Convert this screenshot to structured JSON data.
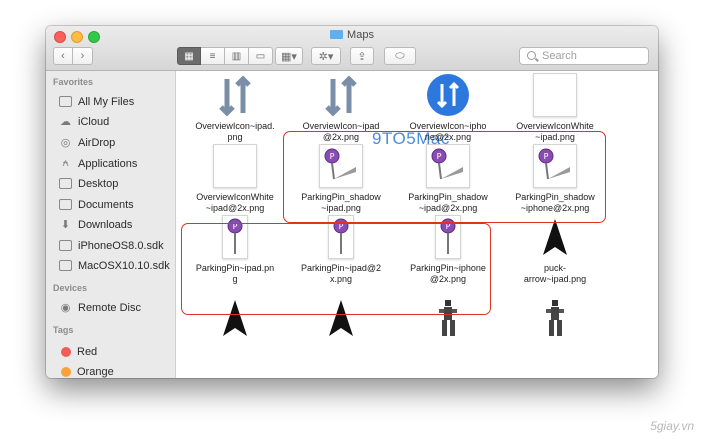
{
  "window": {
    "title": "Maps",
    "toolbar": {
      "search_placeholder": "Search",
      "view_buttons": [
        "icon-view",
        "list-view",
        "column-view",
        "coverflow-view"
      ]
    }
  },
  "sidebar": {
    "favorites_header": "Favorites",
    "favorites": [
      {
        "label": "All My Files",
        "icon": "all-files-icon"
      },
      {
        "label": "iCloud",
        "icon": "cloud-icon"
      },
      {
        "label": "AirDrop",
        "icon": "airdrop-icon"
      },
      {
        "label": "Applications",
        "icon": "applications-icon"
      },
      {
        "label": "Desktop",
        "icon": "desktop-icon"
      },
      {
        "label": "Documents",
        "icon": "documents-icon"
      },
      {
        "label": "Downloads",
        "icon": "downloads-icon"
      },
      {
        "label": "iPhoneOS8.0.sdk",
        "icon": "folder-icon"
      },
      {
        "label": "MacOSX10.10.sdk",
        "icon": "folder-icon"
      }
    ],
    "devices_header": "Devices",
    "devices": [
      {
        "label": "Remote Disc",
        "icon": "disc-icon"
      }
    ],
    "tags_header": "Tags",
    "tags": [
      {
        "label": "Red",
        "color": "#f25c54"
      },
      {
        "label": "Orange",
        "color": "#f7a33a"
      }
    ]
  },
  "files": [
    {
      "name": "OverviewIcon~ipad.\npng",
      "icon": "overview-arrows"
    },
    {
      "name": "OverviewIcon~ipad\n@2x.png",
      "icon": "overview-arrows"
    },
    {
      "name": "OverviewIcon~ipho\nne@2x.png",
      "icon": "overview-blue-circle"
    },
    {
      "name": "OverviewIconWhite\n~ipad.png",
      "icon": "blank"
    },
    {
      "name": "OverviewIconWhite\n~ipad@2x.png",
      "icon": "blank"
    },
    {
      "name": "ParkingPin_shadow\n~ipad.png",
      "icon": "parking-pin-shadow"
    },
    {
      "name": "ParkingPin_shadow\n~ipad@2x.png",
      "icon": "parking-pin-shadow"
    },
    {
      "name": "ParkingPin_shadow\n~iphone@2x.png",
      "icon": "parking-pin-shadow"
    },
    {
      "name": "ParkingPin~ipad.pn\ng",
      "icon": "parking-pin"
    },
    {
      "name": "ParkingPin~ipad@2\nx.png",
      "icon": "parking-pin"
    },
    {
      "name": "ParkingPin~iphone\n@2x.png",
      "icon": "parking-pin"
    },
    {
      "name": "puck-\narrow~ipad.png",
      "icon": "puck-arrow"
    },
    {
      "name": "",
      "icon": "puck-arrow"
    },
    {
      "name": "",
      "icon": "puck-arrow"
    },
    {
      "name": "",
      "icon": "walking-figure"
    },
    {
      "name": "",
      "icon": "walking-figure"
    }
  ],
  "overlay": {
    "watermark": "9TO5Mac",
    "site_mark": "5giay.vn",
    "highlight_color": "#e0321f"
  }
}
